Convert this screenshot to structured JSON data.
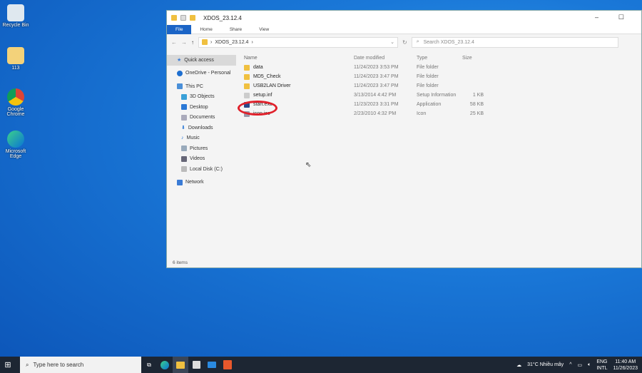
{
  "desktop": {
    "icons": [
      {
        "label": "Recycle Bin"
      },
      {
        "label": "113"
      },
      {
        "label": "Google Chrome"
      },
      {
        "label": "Microsoft Edge"
      }
    ]
  },
  "window": {
    "title": "XDOS_23.12.4",
    "ribbon": [
      "File",
      "Home",
      "Share",
      "View"
    ],
    "address": {
      "path": "XDOS_23.12.4",
      "search_placeholder": "Search XDOS_23.12.4"
    },
    "nav": [
      "Quick access",
      "OneDrive - Personal",
      "This PC",
      "3D Objects",
      "Desktop",
      "Documents",
      "Downloads",
      "Music",
      "Pictures",
      "Videos",
      "Local Disk (C:)",
      "Network"
    ],
    "columns": [
      "Name",
      "Date modified",
      "Type",
      "Size"
    ],
    "files": [
      {
        "name": "data",
        "date": "11/24/2023 3:53 PM",
        "type": "File folder",
        "size": ""
      },
      {
        "name": "MD5_Check",
        "date": "11/24/2023 3:47 PM",
        "type": "File folder",
        "size": ""
      },
      {
        "name": "USB2LAN Driver",
        "date": "11/24/2023 3:47 PM",
        "type": "File folder",
        "size": ""
      },
      {
        "name": "setup.inf",
        "date": "3/13/2014 4:42 PM",
        "type": "Setup Information",
        "size": "1 KB"
      },
      {
        "name": "start.exe",
        "date": "11/23/2023 3:31 PM",
        "type": "Application",
        "size": "58 KB"
      },
      {
        "name": "icon.ico",
        "date": "2/23/2010 4:32 PM",
        "type": "Icon",
        "size": "25 KB"
      }
    ],
    "status": "6 items"
  },
  "taskbar": {
    "search_placeholder": "Type here to search",
    "weather": "31°C  Nhiều mây",
    "lang1": "ENG",
    "lang2": "INTL",
    "time": "11:40 AM",
    "date": "11/26/2023"
  }
}
